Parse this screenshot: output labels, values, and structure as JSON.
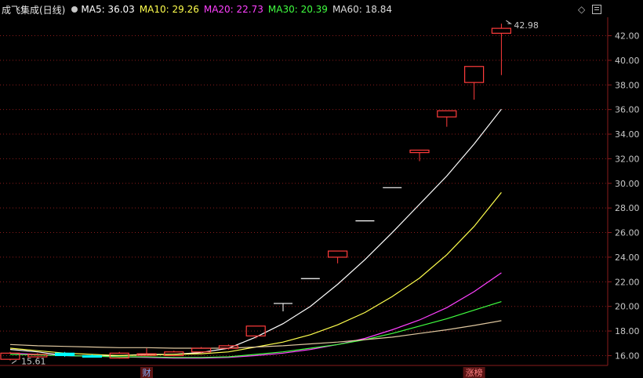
{
  "header": {
    "title": "成飞集成(日线)",
    "ma_items": [
      {
        "label": "MA5: 36.03",
        "color": "#ffffff"
      },
      {
        "label": "MA10: 29.26",
        "color": "#ffff4d"
      },
      {
        "label": "MA20: 22.73",
        "color": "#ff40ff"
      },
      {
        "label": "MA30: 20.39",
        "color": "#40ff40"
      },
      {
        "label": "MA60: 18.84",
        "color": "#dcdcdc"
      }
    ]
  },
  "colors": {
    "up": "#ff3b3b",
    "doji": "#ffffff",
    "down": "#00ffff",
    "grid": "#8a1c1c",
    "axis_label": "#c8c8c8",
    "ma60": "#e0c8a0"
  },
  "chart_data": {
    "type": "candlestick",
    "ylim": [
      15.2,
      43.5
    ],
    "y_ticks": [
      "16.00",
      "18.00",
      "20.00",
      "22.00",
      "24.00",
      "26.00",
      "28.00",
      "30.00",
      "32.00",
      "34.00",
      "36.00",
      "38.00",
      "40.00",
      "42.00"
    ],
    "high_label": "42.98",
    "low_label": "15.61",
    "event_markers": [
      {
        "index": 5,
        "label": "财"
      },
      {
        "index": 17,
        "label": "涨榜"
      }
    ],
    "candles": [
      {
        "o": 15.7,
        "c": 16.2,
        "h": 16.3,
        "l": 15.61
      },
      {
        "o": 15.9,
        "c": 16.1,
        "h": 16.2,
        "l": 15.8
      },
      {
        "o": 16.2,
        "c": 16.0,
        "h": 16.3,
        "l": 15.9
      },
      {
        "o": 16.0,
        "c": 15.95,
        "h": 16.1,
        "l": 15.85
      },
      {
        "o": 15.8,
        "c": 16.2,
        "h": 16.3,
        "l": 15.75
      },
      {
        "o": 16.1,
        "c": 16.15,
        "h": 16.6,
        "l": 16.0
      },
      {
        "o": 16.0,
        "c": 16.3,
        "h": 16.4,
        "l": 15.95
      },
      {
        "o": 16.3,
        "c": 16.6,
        "h": 16.7,
        "l": 16.2
      },
      {
        "o": 16.6,
        "c": 16.8,
        "h": 16.9,
        "l": 16.5
      },
      {
        "o": 17.6,
        "c": 18.4,
        "h": 18.4,
        "l": 17.4
      },
      {
        "o": 20.24,
        "c": 20.24,
        "h": 20.24,
        "l": 19.6
      },
      {
        "o": 22.26,
        "c": 22.26,
        "h": 22.26,
        "l": 22.26
      },
      {
        "o": 24.0,
        "c": 24.5,
        "h": 24.5,
        "l": 23.5
      },
      {
        "o": 26.95,
        "c": 26.95,
        "h": 26.95,
        "l": 26.95
      },
      {
        "o": 29.65,
        "c": 29.65,
        "h": 29.65,
        "l": 29.65
      },
      {
        "o": 32.5,
        "c": 32.7,
        "h": 32.7,
        "l": 31.8
      },
      {
        "o": 35.4,
        "c": 35.9,
        "h": 35.9,
        "l": 34.6
      },
      {
        "o": 38.2,
        "c": 39.5,
        "h": 39.5,
        "l": 36.8
      },
      {
        "o": 42.2,
        "c": 42.6,
        "h": 42.98,
        "l": 38.8
      }
    ],
    "series": [
      {
        "name": "MA5",
        "values": [
          16.5,
          16.3,
          16.0,
          15.95,
          16.0,
          16.1,
          16.1,
          16.25,
          16.6,
          17.5,
          18.6,
          20.0,
          21.8,
          23.8,
          26.0,
          28.3,
          30.6,
          33.2,
          36.03
        ]
      },
      {
        "name": "MA10",
        "values": [
          16.6,
          16.4,
          16.2,
          16.1,
          16.0,
          16.05,
          16.1,
          16.15,
          16.3,
          16.7,
          17.1,
          17.7,
          18.5,
          19.5,
          20.8,
          22.3,
          24.2,
          26.5,
          29.26
        ]
      },
      {
        "name": "MA20",
        "values": [
          16.2,
          16.1,
          16.0,
          15.95,
          15.9,
          15.85,
          15.8,
          15.8,
          15.85,
          16.0,
          16.2,
          16.5,
          16.9,
          17.4,
          18.1,
          18.9,
          19.9,
          21.2,
          22.73
        ]
      },
      {
        "name": "MA30",
        "values": [
          16.1,
          16.05,
          16.0,
          15.95,
          15.9,
          15.9,
          15.85,
          15.85,
          15.9,
          16.1,
          16.3,
          16.6,
          16.9,
          17.3,
          17.8,
          18.4,
          19.0,
          19.7,
          20.39
        ]
      },
      {
        "name": "MA60",
        "values": [
          16.9,
          16.8,
          16.75,
          16.7,
          16.65,
          16.65,
          16.6,
          16.6,
          16.6,
          16.7,
          16.8,
          16.95,
          17.1,
          17.3,
          17.5,
          17.8,
          18.1,
          18.45,
          18.84
        ]
      }
    ]
  }
}
